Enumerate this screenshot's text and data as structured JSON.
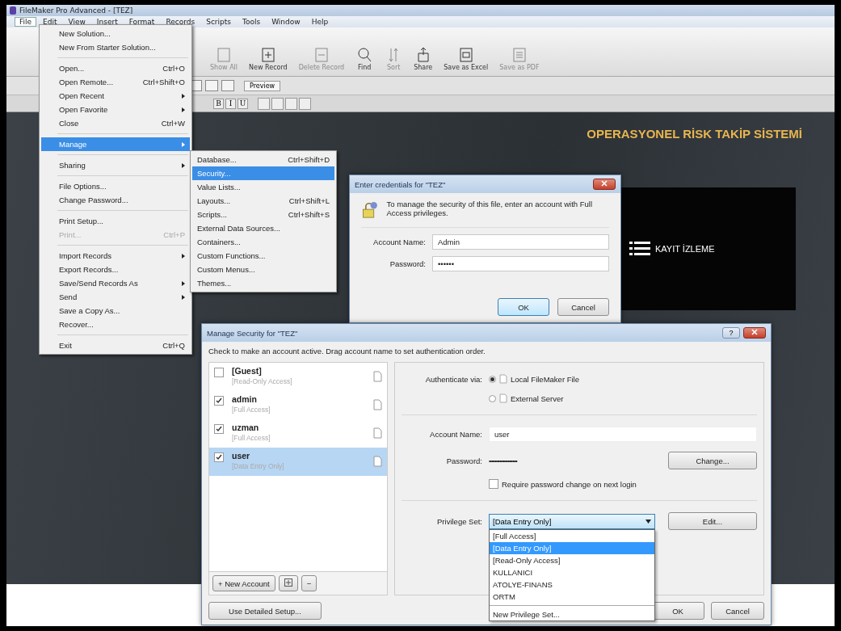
{
  "window": {
    "title": "FileMaker Pro Advanced - [TEZ]"
  },
  "menu_bar": [
    {
      "label": "File",
      "selected": true
    },
    {
      "label": "Edit",
      "selected": false
    },
    {
      "label": "View",
      "selected": false
    },
    {
      "label": "Insert",
      "selected": false
    },
    {
      "label": "Format",
      "selected": false
    },
    {
      "label": "Records",
      "selected": false
    },
    {
      "label": "Scripts",
      "selected": false
    },
    {
      "label": "Tools",
      "selected": false
    },
    {
      "label": "Window",
      "selected": false
    },
    {
      "label": "Help",
      "selected": false
    }
  ],
  "toolbar": [
    {
      "kind": "show-all",
      "label": "Show All",
      "disabled": true
    },
    {
      "kind": "new-record",
      "label": "New Record",
      "disabled": false
    },
    {
      "kind": "delete-record",
      "label": "Delete Record",
      "disabled": true
    },
    {
      "kind": "find",
      "label": "Find",
      "disabled": false
    },
    {
      "kind": "sort",
      "label": "Sort",
      "disabled": true
    },
    {
      "kind": "share",
      "label": "Share",
      "disabled": false
    },
    {
      "kind": "excel",
      "label": "Save as Excel",
      "disabled": false
    },
    {
      "kind": "pdf",
      "label": "Save as PDF",
      "disabled": true
    }
  ],
  "layout_bar": {
    "preview_button": "Preview"
  },
  "format_bar": [
    "B",
    "I",
    "U"
  ],
  "content": {
    "heading": "OPERASYONEL RİSK TAKİP SİSTEMİ",
    "panel_label": "KAYIT İZLEME"
  },
  "file_menu": [
    {
      "kind": "item",
      "label": "New Solution...",
      "submenu": false,
      "selected": false,
      "disabled": false
    },
    {
      "kind": "item",
      "label": "New From Starter Solution...",
      "submenu": false,
      "selected": false,
      "disabled": false
    },
    {
      "kind": "separator"
    },
    {
      "kind": "item",
      "label": "Open...",
      "shortcut": "Ctrl+O",
      "submenu": false,
      "selected": false,
      "disabled": false
    },
    {
      "kind": "item",
      "label": "Open Remote...",
      "shortcut": "Ctrl+Shift+O",
      "submenu": false,
      "selected": false,
      "disabled": false
    },
    {
      "kind": "item",
      "label": "Open Recent",
      "submenu": true,
      "selected": false,
      "disabled": false
    },
    {
      "kind": "item",
      "label": "Open Favorite",
      "submenu": true,
      "selected": false,
      "disabled": false
    },
    {
      "kind": "item",
      "label": "Close",
      "shortcut": "Ctrl+W",
      "submenu": false,
      "selected": false,
      "disabled": false
    },
    {
      "kind": "separator"
    },
    {
      "kind": "item",
      "label": "Manage",
      "submenu": true,
      "selected": true,
      "disabled": false
    },
    {
      "kind": "separator"
    },
    {
      "kind": "item",
      "label": "Sharing",
      "submenu": true,
      "selected": false,
      "disabled": false
    },
    {
      "kind": "separator"
    },
    {
      "kind": "item",
      "label": "File Options...",
      "submenu": false,
      "selected": false,
      "disabled": false
    },
    {
      "kind": "item",
      "label": "Change Password...",
      "submenu": false,
      "selected": false,
      "disabled": false
    },
    {
      "kind": "separator"
    },
    {
      "kind": "item",
      "label": "Print Setup...",
      "submenu": false,
      "selected": false,
      "disabled": false
    },
    {
      "kind": "item",
      "label": "Print...",
      "shortcut": "Ctrl+P",
      "submenu": false,
      "selected": false,
      "disabled": true
    },
    {
      "kind": "separator"
    },
    {
      "kind": "item",
      "label": "Import Records",
      "submenu": true,
      "selected": false,
      "disabled": false
    },
    {
      "kind": "item",
      "label": "Export Records...",
      "submenu": false,
      "selected": false,
      "disabled": false
    },
    {
      "kind": "item",
      "label": "Save/Send Records As",
      "submenu": true,
      "selected": false,
      "disabled": false
    },
    {
      "kind": "item",
      "label": "Send",
      "submenu": true,
      "selected": false,
      "disabled": false
    },
    {
      "kind": "item",
      "label": "Save a Copy As...",
      "submenu": false,
      "selected": false,
      "disabled": false
    },
    {
      "kind": "item",
      "label": "Recover...",
      "submenu": false,
      "selected": false,
      "disabled": false
    },
    {
      "kind": "separator"
    },
    {
      "kind": "item",
      "label": "Exit",
      "shortcut": "Ctrl+Q",
      "submenu": false,
      "selected": false,
      "disabled": false
    }
  ],
  "manage_submenu": [
    {
      "label": "Database...",
      "shortcut": "Ctrl+Shift+D",
      "selected": false
    },
    {
      "label": "Security...",
      "selected": true
    },
    {
      "label": "Value Lists...",
      "selected": false
    },
    {
      "label": "Layouts...",
      "shortcut": "Ctrl+Shift+L",
      "selected": false
    },
    {
      "label": "Scripts...",
      "shortcut": "Ctrl+Shift+S",
      "selected": false
    },
    {
      "label": "External Data Sources...",
      "selected": false
    },
    {
      "label": "Containers...",
      "selected": false
    },
    {
      "label": "Custom Functions...",
      "selected": false
    },
    {
      "label": "Custom Menus...",
      "selected": false
    },
    {
      "label": "Themes...",
      "selected": false
    }
  ],
  "credentials_dialog": {
    "title": "Enter credentials for \"TEZ\"",
    "message": "To manage the security of this file, enter an account with Full Access privileges.",
    "account_name_label": "Account Name:",
    "account_name": "Admin",
    "password_label": "Password:",
    "password": "••••••",
    "ok_button": "OK",
    "cancel_button": "Cancel"
  },
  "security_dialog": {
    "title": "Manage Security for \"TEZ\"",
    "help_button": "?",
    "instruction": "Check to make an account active.  Drag account name to set authentication order.",
    "accounts": [
      {
        "name": "[Guest]",
        "privilege": "[Read-Only Access]",
        "active": false,
        "selected": false
      },
      {
        "name": "admin",
        "privilege": "[Full Access]",
        "active": true,
        "selected": false
      },
      {
        "name": "uzman",
        "privilege": "[Full Access]",
        "active": true,
        "selected": false
      },
      {
        "name": "user",
        "privilege": "[Data Entry Only]",
        "active": true,
        "selected": true
      }
    ],
    "new_account_button": "+ New Account",
    "remove_button": "−",
    "detailed_setup_button": "Use Detailed Setup...",
    "authenticate_label": "Authenticate via:",
    "authenticate_options": [
      {
        "label": "Local FileMaker File",
        "selected": true
      },
      {
        "label": "External Server",
        "selected": false
      }
    ],
    "account_name_label": "Account Name:",
    "account_name": "user",
    "password_label": "Password:",
    "password": "••••••••••••••••••••••••",
    "change_button": "Change...",
    "require_change": {
      "label": "Require password change on next login",
      "checked": false
    },
    "privilege_label": "Privilege Set:",
    "privilege_value": "[Data Entry Only]",
    "edit_button": "Edit...",
    "privilege_options": [
      {
        "label": "[Full Access]",
        "selected": false
      },
      {
        "label": "[Data Entry Only]",
        "selected": true
      },
      {
        "label": "[Read-Only Access]",
        "selected": false
      },
      {
        "label": "KULLANICI",
        "selected": false
      },
      {
        "label": "ATOLYE-FINANS",
        "selected": false
      },
      {
        "label": "ORTM",
        "selected": false
      }
    ],
    "new_privilege_option": "New Privilege Set...",
    "ok_button": "OK",
    "cancel_button": "Cancel"
  }
}
